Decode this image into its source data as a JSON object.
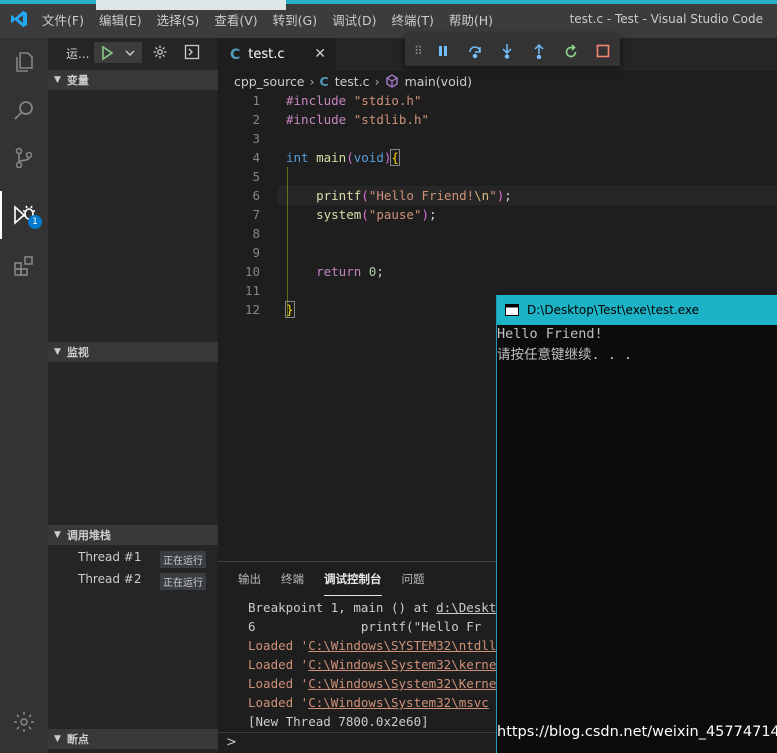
{
  "titlebar": {
    "menu": [
      "文件(F)",
      "编辑(E)",
      "选择(S)",
      "查看(V)",
      "转到(G)",
      "调试(D)",
      "终端(T)",
      "帮助(H)"
    ],
    "title": "test.c - Test - Visual Studio Code"
  },
  "activity": {
    "items": [
      "explorer-icon",
      "search-icon",
      "source-control-icon",
      "debug-icon",
      "extensions-icon"
    ],
    "debug_badge": "1",
    "bottom": "settings-gear-icon"
  },
  "sidebar": {
    "run_label": "运...",
    "sections": {
      "variables": "变量",
      "watch": "监视",
      "callstack": "调用堆栈",
      "breakpoints": "断点"
    },
    "threads": [
      {
        "name": "Thread #1",
        "status": "正在运行"
      },
      {
        "name": "Thread #2",
        "status": "正在运行"
      }
    ]
  },
  "editor": {
    "tab": "test.c",
    "breadcrumb": [
      "cpp_source",
      "test.c",
      "main(void)"
    ],
    "lines": [
      {
        "n": "1",
        "text": "#include \"stdio.h\""
      },
      {
        "n": "2",
        "text": "#include \"stdlib.h\""
      },
      {
        "n": "3",
        "text": ""
      },
      {
        "n": "4",
        "text": "int main(void){"
      },
      {
        "n": "5",
        "text": ""
      },
      {
        "n": "6",
        "text": "    printf(\"Hello Friend!\\n\");"
      },
      {
        "n": "7",
        "text": "    system(\"pause\");"
      },
      {
        "n": "8",
        "text": ""
      },
      {
        "n": "9",
        "text": ""
      },
      {
        "n": "10",
        "text": "    return 0;"
      },
      {
        "n": "11",
        "text": ""
      },
      {
        "n": "12",
        "text": "}"
      }
    ]
  },
  "panel": {
    "tabs": [
      "输出",
      "终端",
      "调试控制台",
      "问题"
    ],
    "active_tab": "调试控制台",
    "lines": [
      "Breakpoint 1, main () at d:\\Deskt",
      "6              printf(\"Hello Fr",
      "Loaded 'C:\\Windows\\SYSTEM32\\ntdll",
      "Loaded 'C:\\Windows\\System32\\kerne",
      "Loaded 'C:\\Windows\\System32\\Kerne",
      "Loaded 'C:\\Windows\\System32\\msvc",
      "[New Thread 7800.0x2e60]"
    ],
    "prompt": ">"
  },
  "console_window": {
    "title": "D:\\Desktop\\Test\\exe\\test.exe",
    "output": [
      "Hello Friend!",
      "请按任意键继续. . ."
    ]
  },
  "watermark": "https://blog.csdn.net/weixin_45774714",
  "colors": {
    "accent": "#007acc",
    "console_titlebar": "#1db3c6",
    "loaded_text": "#ce9178"
  }
}
